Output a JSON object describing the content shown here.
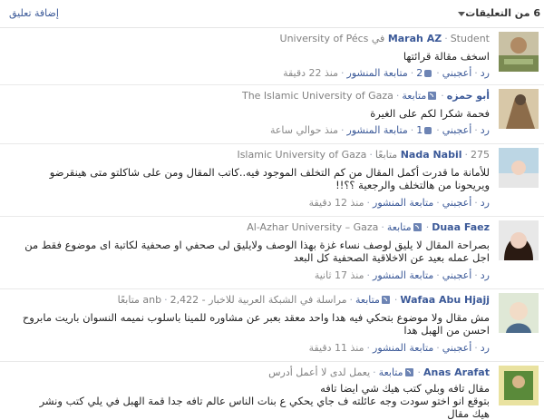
{
  "header": {
    "count_label": "6 من التعليقات",
    "add_comment": "إضافة تعليق"
  },
  "comments": [
    {
      "name": "Marah AZ",
      "meta": "Student في University of Pécs",
      "lines": [
        "اسخف مقالة قرائتها"
      ],
      "reply": "رد",
      "like": "أعجبني",
      "like_count": "2",
      "follow": "متابعة المنشور",
      "time": "منذ 22 دقيقة"
    },
    {
      "name": "أبو حمزه",
      "follow_label": "متابعة",
      "meta": "The Islamic University of Gaza",
      "lines": [
        "فحمة شكرا لكم على الغيرة"
      ],
      "reply": "رد",
      "like": "أعجبني",
      "like_count": "1",
      "follow": "متابعة المنشور",
      "time": "منذ حوالي ساعة"
    },
    {
      "name": "Nada Nabil",
      "followers": "275 متابعًا",
      "meta": "Islamic University of Gaza",
      "lines": [
        "للأمانة ما قدرت أكمل المقال من كم التخلف الموجود فيه..كاتب المقال ومن على شاكلتو متى هينقرضو",
        "ويريحونا من هالتخلف والرجعية ؟؟!!"
      ],
      "reply": "رد",
      "like": "أعجبني",
      "follow": "متابعة المنشور",
      "time": "منذ 12 دقيقة"
    },
    {
      "name": "Duaa Faez",
      "follow_label": "متابعة",
      "meta": "Al-Azhar University – Gaza",
      "lines": [
        "بصراحة المقال لا يليق لوصف نساء غزة بهذا الوصف ولايليق لى صحفي او صحفية لكاتبة اى موضوع فقط من",
        "اجل عمله بعيد عن الاخلاقية الصحفية كل البعد"
      ],
      "reply": "رد",
      "like": "أعجبني",
      "follow": "متابعة المنشور",
      "time": "منذ 17 ثانية"
    },
    {
      "name": "Wafaa Abu Hjajj",
      "follow_label": "متابعة",
      "meta": "مراسلة في الشبكة العربية للاخبار - anb",
      "followers": "2,422 متابعًا",
      "lines": [
        "مش مقال ولا موضوع بتحكي فيه هدا واحد معقد بعبر عن مشاوره للمينا باسلوب نميمه النسوان باريت مابروح",
        "احسن من الهبل هدا"
      ],
      "reply": "رد",
      "like": "أعجبني",
      "follow": "متابعة المنشور",
      "time": "منذ 11 دقيقة"
    },
    {
      "name": "Anas Arafat",
      "follow_label": "متابعة",
      "meta": "يعمل لدى لا أعمل أدرس",
      "lines": [
        "مقال تافه وبلي كتب هيك شي ايضا تافه",
        "بتوقع انو اختو سودت وجه عائلته ف جاي يحكي ع بنات الناس عالم تافه جدا قمة الهبل في يلي كتب ونشر",
        "هيك مقال"
      ]
    }
  ]
}
